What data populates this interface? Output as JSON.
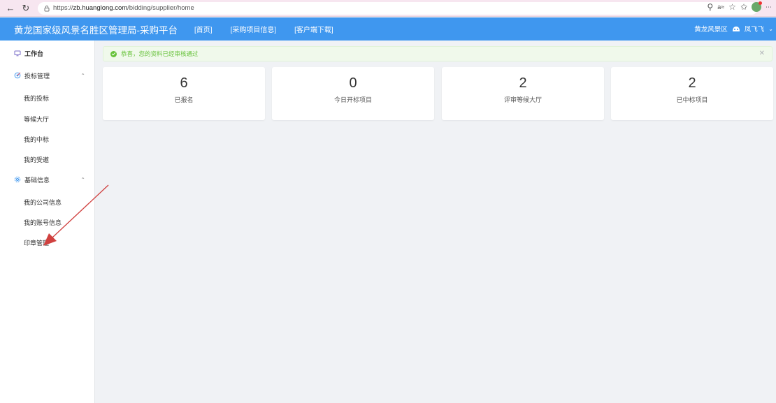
{
  "browser": {
    "url_prefix": "https://",
    "url_host": "zb.huanglong.com",
    "url_path": "/bidding/supplier/home"
  },
  "header": {
    "brand": "黄龙国家级风景名胜区管理局-采购平台",
    "nav": [
      "[首页]",
      "[采购项目信息]",
      "[客户端下载]"
    ],
    "org": "黄龙风景区",
    "user": "凤飞飞"
  },
  "sidebar": {
    "workbench": "工作台",
    "bid_mgmt": "投标管理",
    "bid_items": [
      "我的投标",
      "等候大厅",
      "我的中标",
      "我的受邀"
    ],
    "basic_info": "基础信息",
    "info_items": [
      "我的公司信息",
      "我的账号信息",
      "印章管理"
    ]
  },
  "alert": {
    "message": "恭喜，您的资料已经审核通过"
  },
  "stats": [
    {
      "value": "6",
      "label": "已报名"
    },
    {
      "value": "0",
      "label": "今日开标项目"
    },
    {
      "value": "2",
      "label": "评审等候大厅"
    },
    {
      "value": "2",
      "label": "已中标项目"
    }
  ],
  "colors": {
    "header": "#3f97ef",
    "success": "#67c23a",
    "annotation": "#d0413f"
  }
}
